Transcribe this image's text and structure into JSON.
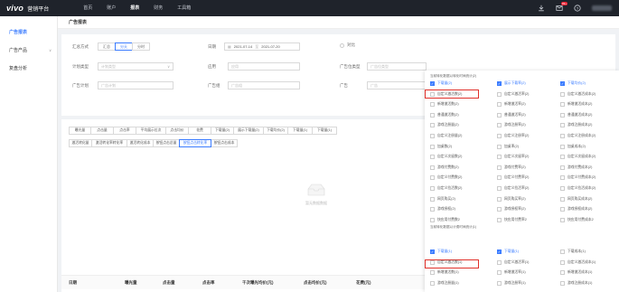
{
  "topbar": {
    "logo": "vivo",
    "app_name": "营销平台",
    "nav": [
      "首页",
      "账户",
      "报表",
      "财务",
      "工具箱"
    ],
    "active_nav": 2,
    "mail_badge": "99+"
  },
  "sidebar": {
    "items": [
      {
        "label": "广告报表",
        "active": true,
        "chev": ""
      },
      {
        "label": "广告产品",
        "active": false,
        "chev": "∨"
      },
      {
        "label": "复盘分析",
        "active": false,
        "chev": ""
      }
    ]
  },
  "page_title": "广告报表",
  "filters": {
    "summary_label": "汇总方式",
    "summary_options": [
      "汇总",
      "分天",
      "分时"
    ],
    "summary_active": 1,
    "date_label": "日期",
    "date_start": "2021-07-14",
    "date_sep": "至",
    "date_end": "2021-07-20",
    "compare_label": "对比",
    "plan_type_label": "计划类型",
    "plan_type_placeholder": "计划类型",
    "app_label": "应用",
    "app_placeholder": "应用",
    "position_type_label": "广告位类型",
    "position_type_placeholder": "广告位类型",
    "plan_label": "广告计划",
    "plan_placeholder": "广告计划",
    "group_label": "广告组",
    "group_placeholder": "广告组",
    "ad_label": "广告",
    "ad_placeholder": "广告"
  },
  "metric_tabs_row1": [
    "曝光量",
    "点击量",
    "点击率",
    "平均展示位次",
    "点击均价",
    "花费",
    "下载量(2)",
    "展示下载量(2)",
    "下载均价(2)",
    "下载量(1)",
    "下载量(1)"
  ],
  "metric_tabs_row1_active": -1,
  "metric_tabs_row2": [
    "激活转化量",
    "激活转化率转化率",
    "激活转化成本",
    "按钮点击总量",
    "按钮点击转化率",
    "按钮点击成本"
  ],
  "metric_tabs_row2_active": 4,
  "empty_text": "暂无数据数据",
  "table_headers": [
    "日期",
    "曝光量",
    "点击量",
    "点击率",
    "千次曝光均价(元)",
    "点击均价(元)",
    "花费(元)"
  ],
  "popover": {
    "section1_title": "当前转化数据以转化时间统计(2)",
    "section1_items": [
      {
        "label": "下载量(2)",
        "on": true
      },
      {
        "label": "展示下载率(2)",
        "on": true
      },
      {
        "label": "下载均价(2)",
        "on": true
      },
      {
        "label": "自定义激活数(2)",
        "on": false
      },
      {
        "label": "自定义激活率(2)",
        "on": false
      },
      {
        "label": "自定义激活成本(2)",
        "on": false
      },
      {
        "label": "新增激活数(2)",
        "on": false
      },
      {
        "label": "新增激活率(2)",
        "on": false
      },
      {
        "label": "新增激活成本(2)",
        "on": false
      },
      {
        "label": "普通激活数(2)",
        "on": false
      },
      {
        "label": "普通激活率(2)",
        "on": false
      },
      {
        "label": "普通激活成本(2)",
        "on": false
      },
      {
        "label": "游戏注册量(2)",
        "on": false
      },
      {
        "label": "游戏注册率(2)",
        "on": false
      },
      {
        "label": "游戏注册成本(2)",
        "on": false
      },
      {
        "label": "自定义注册量(2)",
        "on": false
      },
      {
        "label": "自定义注册率(2)",
        "on": false
      },
      {
        "label": "自定义注册成本(2)",
        "on": false
      },
      {
        "label": "加桌数(2)",
        "on": false
      },
      {
        "label": "加桌率(2)",
        "on": false
      },
      {
        "label": "加桌成本(2)",
        "on": false
      },
      {
        "label": "自定义次留数(2)",
        "on": false
      },
      {
        "label": "自定义次留率(2)",
        "on": false
      },
      {
        "label": "自定义次留成本(2)",
        "on": false
      },
      {
        "label": "游戏付费数(2)",
        "on": false
      },
      {
        "label": "游戏付费率(2)",
        "on": false
      },
      {
        "label": "游戏付费成本(2)",
        "on": false
      },
      {
        "label": "自定义付费数(2)",
        "on": false
      },
      {
        "label": "自定义付费率(2)",
        "on": false
      },
      {
        "label": "自定义付费成本(2)",
        "on": false
      },
      {
        "label": "自定义拉活数(2)",
        "on": false
      },
      {
        "label": "自定义拉活率(2)",
        "on": false
      },
      {
        "label": "自定义拉活成本(2)",
        "on": false
      },
      {
        "label": "网页购买(2)",
        "on": false
      },
      {
        "label": "网页购买率(2)",
        "on": false
      },
      {
        "label": "网页购买成本(2)",
        "on": false
      },
      {
        "label": "游戏授权(2)",
        "on": false
      },
      {
        "label": "游戏授权率(2)",
        "on": false
      },
      {
        "label": "游戏授权成本(2)",
        "on": false
      },
      {
        "label": "快应用付费数2",
        "on": false
      },
      {
        "label": "快应用付费率2",
        "on": false
      },
      {
        "label": "快应用付费成本2",
        "on": false
      }
    ],
    "section2_title": "当前转化数据以计费时间统计(1)",
    "section2_items": [
      {
        "label": "下载量(1)",
        "on": true
      },
      {
        "label": "下载量(1)",
        "on": true
      },
      {
        "label": "下载成本(1)",
        "on": false
      },
      {
        "label": "自定义激活数(1)",
        "on": false
      },
      {
        "label": "自定义激活率(1)",
        "on": false
      },
      {
        "label": "自定义激活成本(1)",
        "on": false
      },
      {
        "label": "新增激活数(1)",
        "on": false
      },
      {
        "label": "新增激活率(1)",
        "on": false
      },
      {
        "label": "新增激活成本(1)",
        "on": false
      },
      {
        "label": "游戏注册量(1)",
        "on": false
      },
      {
        "label": "游戏注册率(1)",
        "on": false
      },
      {
        "label": "游戏注册成本(1)",
        "on": false
      }
    ]
  }
}
